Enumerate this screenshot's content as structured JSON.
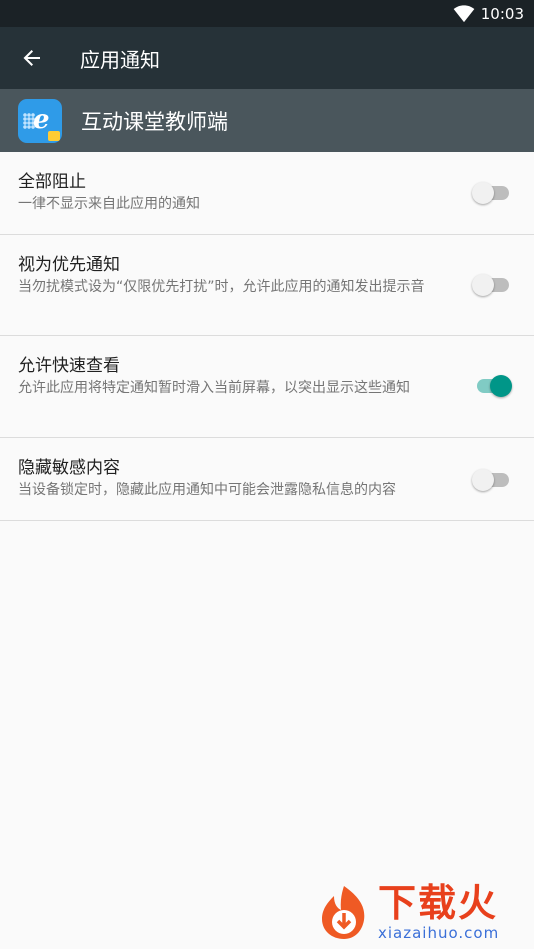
{
  "status_bar": {
    "time": "10:03",
    "wifi_icon": "wifi-icon"
  },
  "app_bar": {
    "back_icon": "arrow-back-icon",
    "title": "应用通知"
  },
  "app_header": {
    "app_name": "互动课堂教师端",
    "icon": "app-icon"
  },
  "settings": [
    {
      "label": "全部阻止",
      "desc": "一律不显示来自此应用的通知",
      "enabled": false
    },
    {
      "label": "视为优先通知",
      "desc": "当勿扰模式设为“仅限优先打扰”时，允许此应用的通知发出提示音",
      "enabled": false
    },
    {
      "label": "允许快速查看",
      "desc": "允许此应用将特定通知暂时滑入当前屏幕，以突出显示这些通知",
      "enabled": true
    },
    {
      "label": "隐藏敏感内容",
      "desc": "当设备锁定时，隐藏此应用通知中可能会泄露隐私信息的内容",
      "enabled": false
    }
  ],
  "watermark": {
    "title": "下载火",
    "url": "xiazaihuo.com"
  },
  "colors": {
    "status_bar": "#1b2226",
    "app_bar": "#263238",
    "app_header": "#4a565c",
    "accent": "#009688",
    "accent_track": "#80cbc4",
    "watermark": "#e8401c"
  }
}
